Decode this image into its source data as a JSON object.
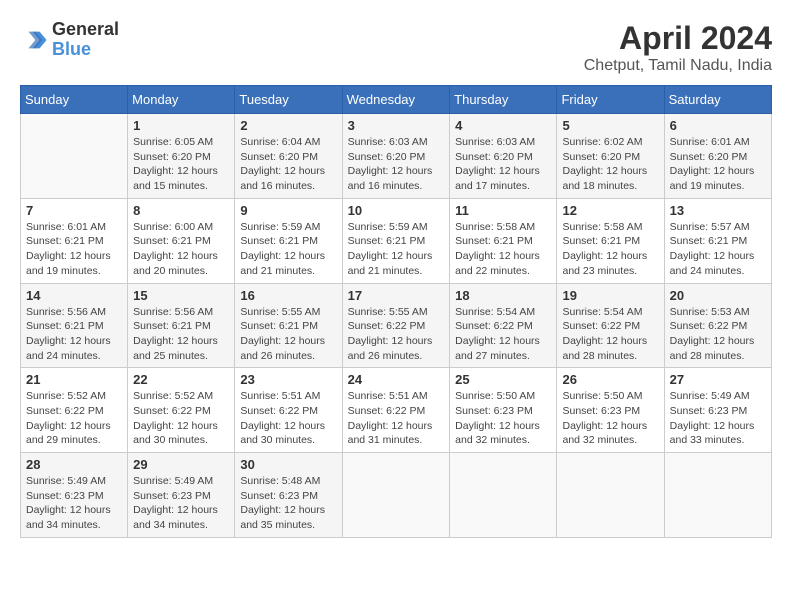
{
  "header": {
    "logo_line1": "General",
    "logo_line2": "Blue",
    "month_year": "April 2024",
    "location": "Chetput, Tamil Nadu, India"
  },
  "days_of_week": [
    "Sunday",
    "Monday",
    "Tuesday",
    "Wednesday",
    "Thursday",
    "Friday",
    "Saturday"
  ],
  "weeks": [
    [
      {
        "day": "",
        "info": ""
      },
      {
        "day": "1",
        "info": "Sunrise: 6:05 AM\nSunset: 6:20 PM\nDaylight: 12 hours\nand 15 minutes."
      },
      {
        "day": "2",
        "info": "Sunrise: 6:04 AM\nSunset: 6:20 PM\nDaylight: 12 hours\nand 16 minutes."
      },
      {
        "day": "3",
        "info": "Sunrise: 6:03 AM\nSunset: 6:20 PM\nDaylight: 12 hours\nand 16 minutes."
      },
      {
        "day": "4",
        "info": "Sunrise: 6:03 AM\nSunset: 6:20 PM\nDaylight: 12 hours\nand 17 minutes."
      },
      {
        "day": "5",
        "info": "Sunrise: 6:02 AM\nSunset: 6:20 PM\nDaylight: 12 hours\nand 18 minutes."
      },
      {
        "day": "6",
        "info": "Sunrise: 6:01 AM\nSunset: 6:20 PM\nDaylight: 12 hours\nand 19 minutes."
      }
    ],
    [
      {
        "day": "7",
        "info": "Sunrise: 6:01 AM\nSunset: 6:21 PM\nDaylight: 12 hours\nand 19 minutes."
      },
      {
        "day": "8",
        "info": "Sunrise: 6:00 AM\nSunset: 6:21 PM\nDaylight: 12 hours\nand 20 minutes."
      },
      {
        "day": "9",
        "info": "Sunrise: 5:59 AM\nSunset: 6:21 PM\nDaylight: 12 hours\nand 21 minutes."
      },
      {
        "day": "10",
        "info": "Sunrise: 5:59 AM\nSunset: 6:21 PM\nDaylight: 12 hours\nand 21 minutes."
      },
      {
        "day": "11",
        "info": "Sunrise: 5:58 AM\nSunset: 6:21 PM\nDaylight: 12 hours\nand 22 minutes."
      },
      {
        "day": "12",
        "info": "Sunrise: 5:58 AM\nSunset: 6:21 PM\nDaylight: 12 hours\nand 23 minutes."
      },
      {
        "day": "13",
        "info": "Sunrise: 5:57 AM\nSunset: 6:21 PM\nDaylight: 12 hours\nand 24 minutes."
      }
    ],
    [
      {
        "day": "14",
        "info": "Sunrise: 5:56 AM\nSunset: 6:21 PM\nDaylight: 12 hours\nand 24 minutes."
      },
      {
        "day": "15",
        "info": "Sunrise: 5:56 AM\nSunset: 6:21 PM\nDaylight: 12 hours\nand 25 minutes."
      },
      {
        "day": "16",
        "info": "Sunrise: 5:55 AM\nSunset: 6:21 PM\nDaylight: 12 hours\nand 26 minutes."
      },
      {
        "day": "17",
        "info": "Sunrise: 5:55 AM\nSunset: 6:22 PM\nDaylight: 12 hours\nand 26 minutes."
      },
      {
        "day": "18",
        "info": "Sunrise: 5:54 AM\nSunset: 6:22 PM\nDaylight: 12 hours\nand 27 minutes."
      },
      {
        "day": "19",
        "info": "Sunrise: 5:54 AM\nSunset: 6:22 PM\nDaylight: 12 hours\nand 28 minutes."
      },
      {
        "day": "20",
        "info": "Sunrise: 5:53 AM\nSunset: 6:22 PM\nDaylight: 12 hours\nand 28 minutes."
      }
    ],
    [
      {
        "day": "21",
        "info": "Sunrise: 5:52 AM\nSunset: 6:22 PM\nDaylight: 12 hours\nand 29 minutes."
      },
      {
        "day": "22",
        "info": "Sunrise: 5:52 AM\nSunset: 6:22 PM\nDaylight: 12 hours\nand 30 minutes."
      },
      {
        "day": "23",
        "info": "Sunrise: 5:51 AM\nSunset: 6:22 PM\nDaylight: 12 hours\nand 30 minutes."
      },
      {
        "day": "24",
        "info": "Sunrise: 5:51 AM\nSunset: 6:22 PM\nDaylight: 12 hours\nand 31 minutes."
      },
      {
        "day": "25",
        "info": "Sunrise: 5:50 AM\nSunset: 6:23 PM\nDaylight: 12 hours\nand 32 minutes."
      },
      {
        "day": "26",
        "info": "Sunrise: 5:50 AM\nSunset: 6:23 PM\nDaylight: 12 hours\nand 32 minutes."
      },
      {
        "day": "27",
        "info": "Sunrise: 5:49 AM\nSunset: 6:23 PM\nDaylight: 12 hours\nand 33 minutes."
      }
    ],
    [
      {
        "day": "28",
        "info": "Sunrise: 5:49 AM\nSunset: 6:23 PM\nDaylight: 12 hours\nand 34 minutes."
      },
      {
        "day": "29",
        "info": "Sunrise: 5:49 AM\nSunset: 6:23 PM\nDaylight: 12 hours\nand 34 minutes."
      },
      {
        "day": "30",
        "info": "Sunrise: 5:48 AM\nSunset: 6:23 PM\nDaylight: 12 hours\nand 35 minutes."
      },
      {
        "day": "",
        "info": ""
      },
      {
        "day": "",
        "info": ""
      },
      {
        "day": "",
        "info": ""
      },
      {
        "day": "",
        "info": ""
      }
    ]
  ]
}
